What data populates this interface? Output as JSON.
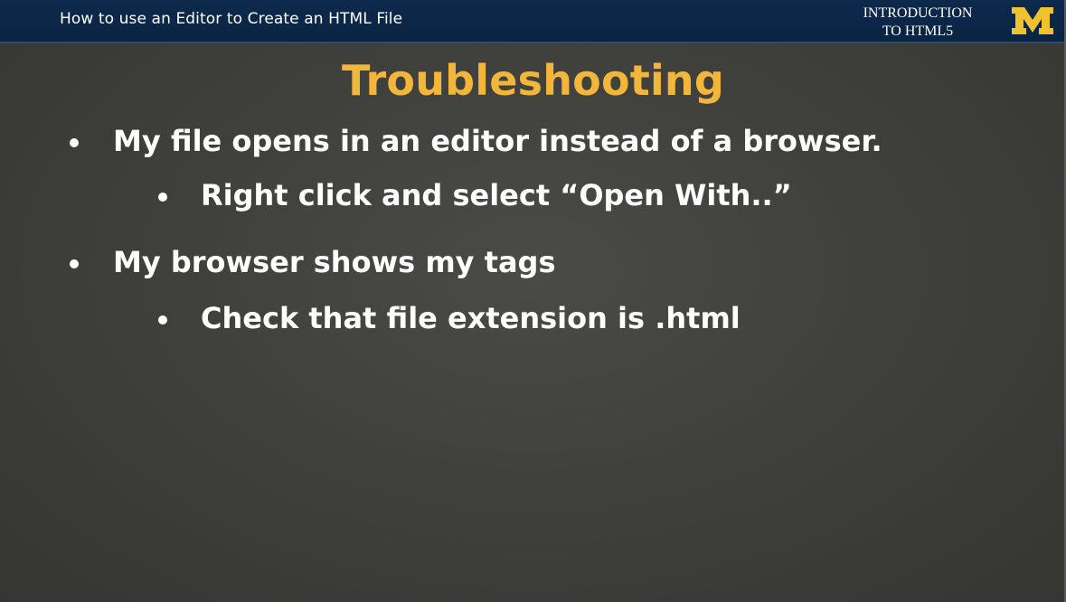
{
  "header": {
    "title": "How to use an Editor to Create an HTML File",
    "course_line1": "INTRODUCTION",
    "course_line2": "TO HTML5",
    "logo_letter": "M",
    "logo_color": "#f2c12e"
  },
  "slide": {
    "title": "Troubleshooting",
    "title_color": "#f2b73a",
    "bullets": [
      {
        "text": "My file opens in an editor instead of a browser.",
        "sub": [
          "Right click and select “Open With..”"
        ]
      },
      {
        "text": "My browser shows my tags",
        "sub": [
          "Check that file extension is .html"
        ]
      }
    ]
  }
}
